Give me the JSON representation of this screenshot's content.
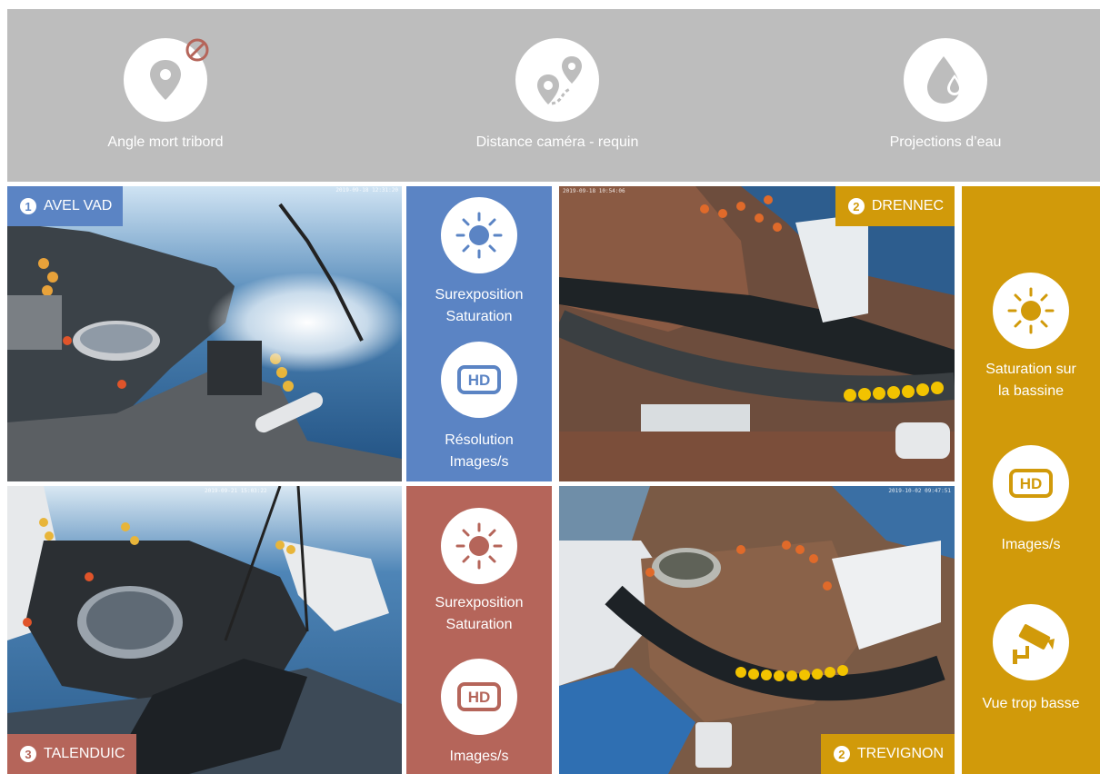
{
  "top_banner": {
    "items": [
      {
        "icon": "location-pin-blocked-icon",
        "label": "Angle mort  tribord"
      },
      {
        "icon": "route-distance-icon",
        "label": "Distance caméra - requin"
      },
      {
        "icon": "water-drop-icon",
        "label": "Projections d’eau"
      }
    ]
  },
  "cameras": [
    {
      "number": "1",
      "name": "AVEL VAD",
      "color": "#5b84c4",
      "timestamp": "2019-09-18 12:31:20"
    },
    {
      "number": "2",
      "name": "DRENNEC",
      "color": "#d19a0a",
      "timestamp": "2019-09-18 10:54:06"
    },
    {
      "number": "3",
      "name": "TALENDUIC",
      "color": "#b5655a",
      "timestamp": "2019-09-21 15:03:22"
    },
    {
      "number": "2",
      "name": "TREVIGNON",
      "color": "#d19a0a",
      "timestamp": "2019-10-02 09:47:51"
    }
  ],
  "issues": {
    "blue": {
      "color": "#5b84c4",
      "items": [
        {
          "icon": "sun-icon",
          "label_line1": "Surexposition",
          "label_line2": "Saturation"
        },
        {
          "icon": "hd-icon",
          "label_line1": "Résolution",
          "label_line2": "Images/s"
        }
      ]
    },
    "red": {
      "color": "#b5655a",
      "items": [
        {
          "icon": "sun-icon",
          "label_line1": "Surexposition",
          "label_line2": "Saturation"
        },
        {
          "icon": "hd-icon",
          "label_line1": "Images/s",
          "label_line2": ""
        }
      ]
    },
    "gold": {
      "color": "#d19a0a",
      "items": [
        {
          "icon": "sun-icon",
          "label_line1": "Saturation sur",
          "label_line2": "la bassine"
        },
        {
          "icon": "hd-icon",
          "label_line1": "Images/s",
          "label_line2": ""
        },
        {
          "icon": "security-camera-icon",
          "label_line1": "Vue trop basse",
          "label_line2": ""
        }
      ]
    }
  }
}
